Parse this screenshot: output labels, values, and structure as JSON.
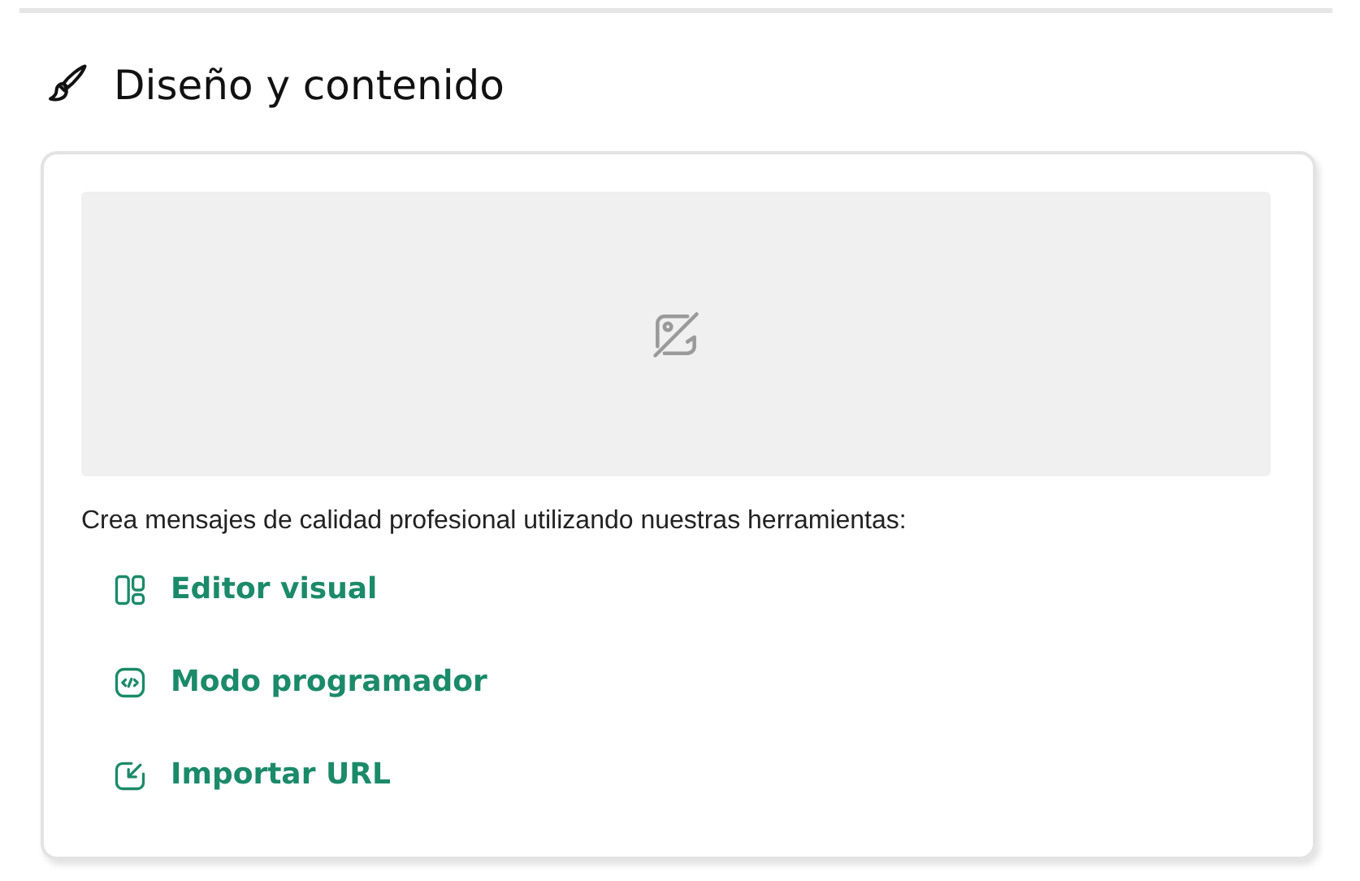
{
  "section": {
    "title": "Diseño y contenido"
  },
  "card": {
    "description": "Crea mensajes de calidad profesional utilizando nuestras herramientas:",
    "links": [
      {
        "kind": "layout",
        "label": "Editor visual"
      },
      {
        "kind": "code",
        "label": "Modo programador"
      },
      {
        "kind": "import",
        "label": "Importar URL"
      }
    ]
  }
}
